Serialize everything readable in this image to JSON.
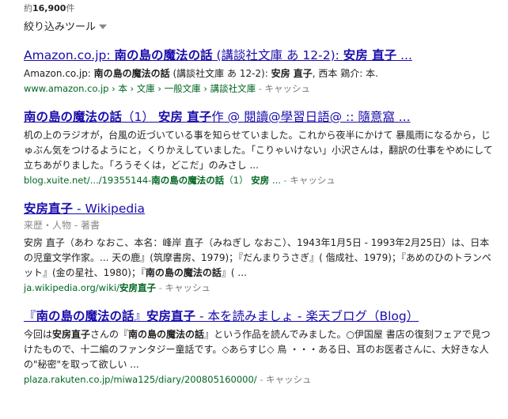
{
  "stats": {
    "prefix": "約",
    "count": "16,900",
    "suffix": "件"
  },
  "tools": {
    "label": "絞り込みツール"
  },
  "results": [
    {
      "title": [
        {
          "t": "Amazon.co.jp: ",
          "b": false
        },
        {
          "t": "南の島の",
          "b": true
        },
        {
          "t": "魔法",
          "b": true
        },
        {
          "t": "の話",
          "b": true
        },
        {
          "t": " (講談社文庫 あ 12-2): ",
          "b": false
        },
        {
          "t": "安房 直子",
          "b": true
        },
        {
          "t": " ...",
          "b": false
        }
      ],
      "snippet": [
        {
          "t": "Amazon.co.jp: ",
          "b": false
        },
        {
          "t": "南の島の魔法の話",
          "b": true
        },
        {
          "t": " (講談社文庫 あ 12-2): ",
          "b": false
        },
        {
          "t": "安房 直子",
          "b": true
        },
        {
          "t": ", 西本 鶏介: 本.",
          "b": false
        }
      ],
      "url": [
        {
          "t": "www.amazon.co.jp › 本 › 文庫 › 一般文庫 › 講談社文庫",
          "b": false
        }
      ],
      "cache": "キャッシュ"
    },
    {
      "title": [
        {
          "t": "南の島の魔法の話",
          "b": true
        },
        {
          "t": "（1） ",
          "b": false
        },
        {
          "t": "安房 直子",
          "b": true
        },
        {
          "t": "作 @ 閱讀@學習日語@ :: 隨意窩 ...",
          "b": false
        }
      ],
      "snippet": [
        {
          "t": "机の上のラジオが，台風の近づいている事を知らせていました。これから夜半にかけて 暴風雨になるから，じゅぶん気をつけるようにと，くりかえしていました。「こりゃいけない」小沢さんは，翻訳の仕事をやめにして立ちあがりました。「ろうそくは，どこだ」のみさし ...",
          "b": false
        }
      ],
      "url": [
        {
          "t": "blog.xuite.net/.../19355144-",
          "b": false
        },
        {
          "t": "南の島の魔法の話",
          "b": true
        },
        {
          "t": "（1）   ",
          "b": false
        },
        {
          "t": "安房",
          "b": true
        },
        {
          "t": " ...",
          "b": false
        }
      ],
      "cache": "キャッシュ"
    },
    {
      "title": [
        {
          "t": "安房直子",
          "b": true
        },
        {
          "t": " - Wikipedia",
          "b": false
        }
      ],
      "sitelinks": [
        "来歴・人物",
        "著書"
      ],
      "snippet": [
        {
          "t": "安房 直子（あわ なおこ、本名：峰岸 直子（みねぎし なおこ）、1943年1月5日 - 1993年2月25日）は、日本の児童文学作家。... 天の鹿』(筑摩書房、1979)；『だんまりうさぎ』( 偕成社、1979)；『あめのひのトランペット』(金の星社、1980)；『",
          "b": false
        },
        {
          "t": "南の島の魔法の話",
          "b": true
        },
        {
          "t": "』( ...",
          "b": false
        }
      ],
      "url": [
        {
          "t": "ja.wikipedia.org/wiki/",
          "b": false
        },
        {
          "t": "安房直子",
          "b": true
        }
      ],
      "cache": "キャッシュ"
    },
    {
      "title": [
        {
          "t": "『",
          "b": false
        },
        {
          "t": "南の島の魔法の話",
          "b": true
        },
        {
          "t": "』",
          "b": false
        },
        {
          "t": "安房直子",
          "b": true
        },
        {
          "t": " - 本を読みましょ - 楽天ブログ（Blog）",
          "b": false
        }
      ],
      "snippet": [
        {
          "t": "今回は",
          "b": false
        },
        {
          "t": "安房直子",
          "b": true
        },
        {
          "t": "さんの『",
          "b": false
        },
        {
          "t": "南の島の魔法の話",
          "b": true
        },
        {
          "t": "』という作品を読んでみました。○伊国屋 書店の復刻フェアで見つけたもので、十二編のファンタジー童話です。◇あらすじ◇ 鳥 ・・・ある日、耳のお医者さんに、大好きな人の\"秘密\"を取って欲しい ...",
          "b": false
        }
      ],
      "url": [
        {
          "t": "plaza.rakuten.co.jp/miwa125/diary/200805160000/",
          "b": false
        }
      ],
      "cache": "キャッシュ"
    }
  ]
}
